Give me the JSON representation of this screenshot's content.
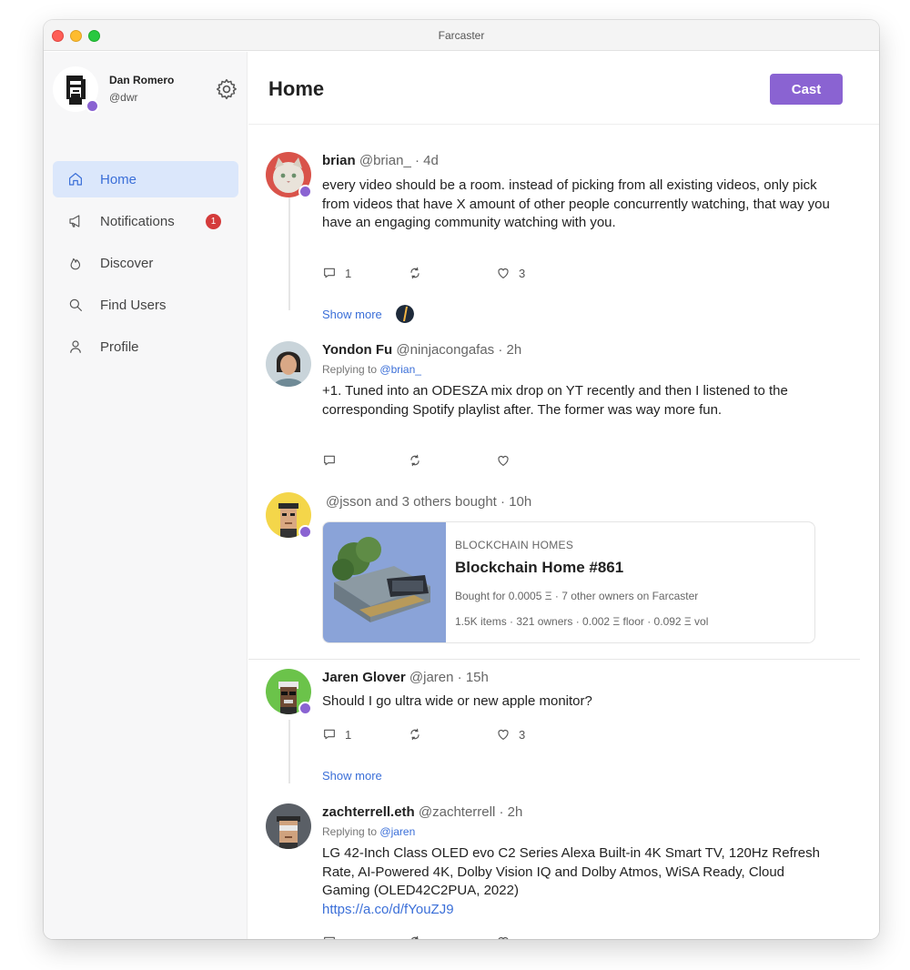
{
  "window": {
    "title": "Farcaster"
  },
  "user": {
    "name": "Dan Romero",
    "handle": "@dwr"
  },
  "nav": [
    {
      "label": "Home",
      "icon": "home-icon",
      "active": true
    },
    {
      "label": "Notifications",
      "icon": "megaphone-icon",
      "badge": "1"
    },
    {
      "label": "Discover",
      "icon": "flame-icon"
    },
    {
      "label": "Find Users",
      "icon": "search-icon"
    },
    {
      "label": "Profile",
      "icon": "person-icon"
    }
  ],
  "header": {
    "title": "Home",
    "cast_label": "Cast"
  },
  "colors": {
    "accent": "#8a63d2",
    "active_nav_bg": "#dbe7fb",
    "link": "#3b6fd8",
    "badge": "#d43b3b"
  },
  "feed": {
    "post1": {
      "name": "brian",
      "handle": "@brian_",
      "time": "· 4d",
      "text": "every video should be a room. instead of picking from all existing videos, only pick from videos that have X amount of other people concurrently watching, that way you have an engaging community watching with you.",
      "replies": "1",
      "likes": "3",
      "show_more": "Show more"
    },
    "post2": {
      "name": "Yondon Fu",
      "handle": "@ninjacongafas",
      "time": "· 2h",
      "replying_prefix": "Replying to",
      "replying_to": "@brian_",
      "text": "+1. Tuned into an ODESZA mix drop on YT recently and then I listened to the corresponding Spotify playlist after. The former was way more fun."
    },
    "post3": {
      "activity": "@jsson and 3 others bought",
      "time": "· 10h",
      "nft": {
        "collection": "BLOCKCHAIN HOMES",
        "title": "Blockchain Home #861",
        "bought": "Bought for 0.0005 Ξ · 7 other owners on Farcaster",
        "stats": "1.5K items · 321 owners · 0.002 Ξ floor · 0.092 Ξ vol"
      }
    },
    "post4": {
      "name": "Jaren Glover",
      "handle": "@jaren",
      "time": "· 15h",
      "text": "Should I go ultra wide or new apple monitor?",
      "replies": "1",
      "likes": "3",
      "show_more": "Show more"
    },
    "post5": {
      "name": "zachterrell.eth",
      "handle": "@zachterrell",
      "time": "· 2h",
      "replying_prefix": "Replying to",
      "replying_to": "@jaren",
      "text": "LG 42-Inch Class OLED evo C2 Series Alexa Built-in 4K Smart TV, 120Hz Refresh Rate, AI-Powered 4K, Dolby Vision IQ and Dolby Atmos, WiSA Ready, Cloud Gaming (OLED42C2PUA, 2022)",
      "link": "https://a.co/d/fYouZJ9"
    }
  }
}
